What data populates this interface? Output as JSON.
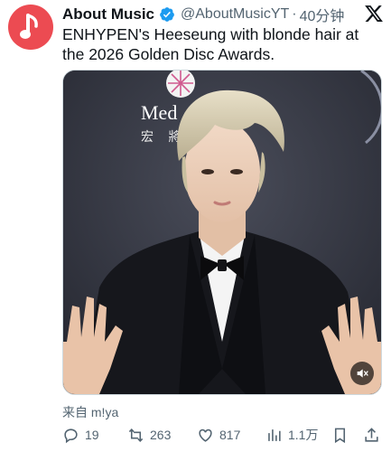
{
  "tweet": {
    "author_name": "About Music",
    "handle": "@AboutMusicYT",
    "separator": "·",
    "time": "40分钟",
    "text": "ENHYPEN's Heeseung with blonde hair at the 2026 Golden Disc Awards.",
    "source": "来自 m!ya"
  },
  "media": {
    "backdrop_text": "Med",
    "backdrop_text_cn": "宏 將"
  },
  "actions": {
    "replies": "19",
    "retweets": "263",
    "likes": "817",
    "views": "1.1万"
  },
  "colors": {
    "avatar_bg": "#ec4b52",
    "verified": "#1d9bf0",
    "muted_text": "#536471"
  },
  "icons": [
    "music-note-icon",
    "verified-badge-icon",
    "x-logo-icon",
    "mute-icon",
    "reply-icon",
    "retweet-icon",
    "like-icon",
    "views-icon",
    "bookmark-icon",
    "share-icon"
  ]
}
